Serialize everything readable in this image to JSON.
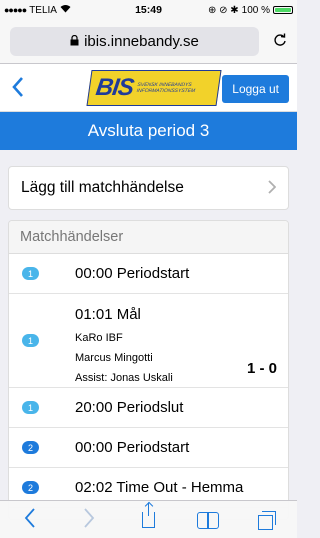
{
  "status": {
    "carrier": "TELIA",
    "signal": "●●●●●",
    "wifi_icon": "wifi-icon",
    "time": "15:49",
    "indicators": "⊕ ⊘ ✱",
    "battery": "100 %",
    "battery_color": "#4cd964"
  },
  "browser": {
    "url": "ibis.innebandy.se",
    "lock_icon": "lock-icon",
    "reload_icon": "reload-icon"
  },
  "header": {
    "back": "<",
    "logo_text": "BIS",
    "logo_sub": "SVENSK INNEBANDYS INFORMATIONSSYSTEM",
    "logout": "Logga ut"
  },
  "period_bar": {
    "label": "Avsluta period 3"
  },
  "add_event": {
    "label": "Lägg till matchhändelse",
    "chevron": ">"
  },
  "events": {
    "heading": "Matchhändelser",
    "rows": [
      {
        "period": "1",
        "title": "00:00 Periodstart"
      },
      {
        "period": "1",
        "title": "01:01 Mål",
        "team": "KaRo IBF",
        "player": "Marcus Mingotti",
        "assist": "Assist: Jonas Uskali",
        "score": "1 - 0"
      },
      {
        "period": "1",
        "title": "20:00 Periodslut"
      },
      {
        "period": "2",
        "title": "00:00 Periodstart"
      },
      {
        "period": "2",
        "title": "02:02 Time Out - Hemma"
      }
    ]
  },
  "toolbar": {
    "back": "<",
    "forward": ">"
  },
  "colors": {
    "accent": "#1e7bdc",
    "badge_light": "#49b5ea",
    "logo_yellow": "#f2d22a"
  }
}
